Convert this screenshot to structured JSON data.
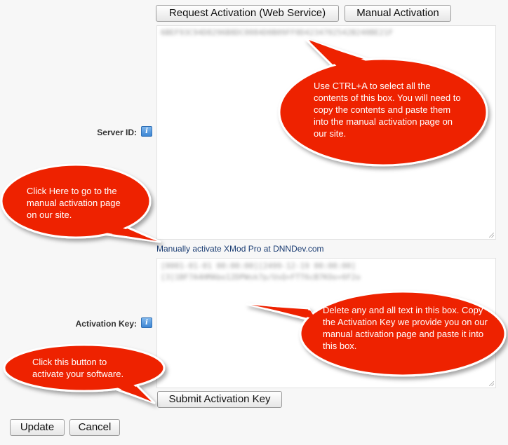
{
  "toolbar": {
    "request_label": "Request Activation (Web Service)",
    "manual_label": "Manual Activation"
  },
  "server_id": {
    "label": "Server ID:",
    "help_icon": "help-icon",
    "value": "6BEF93C94D8296B8DC0084D0B09FF0D4234702542B240BE21F"
  },
  "link": {
    "text": "Manually activate XMod Pro at DNNDev.com"
  },
  "activation_key": {
    "label": "Activation Key:",
    "help_icon": "help-icon",
    "value": "[0001-01-01 00:00:00][2499-12-19 00:00:00]\n[3]1BF7A4HMAbo12DPWsk7p/UsQ+FTT6cB7KOo+6F2o"
  },
  "submit_label": "Submit Activation Key",
  "footer": {
    "update_label": "Update",
    "cancel_label": "Cancel"
  },
  "callouts": {
    "select_box": "Use CTRL+A to select all the contents of this box. You will need to copy the contents and paste them into the manual activation page on our site.",
    "click_here": "Click Here to go to the manual activation page on our site.",
    "delete_text": "Delete any and all text in this box. Copy the Activation Key we provide you on our manual activation page and paste it into this box.",
    "click_button": "Click this button to activate your software."
  },
  "colors": {
    "callout_fill": "#ee2200",
    "callout_stroke": "#ffffff",
    "link": "#1b3d73"
  }
}
